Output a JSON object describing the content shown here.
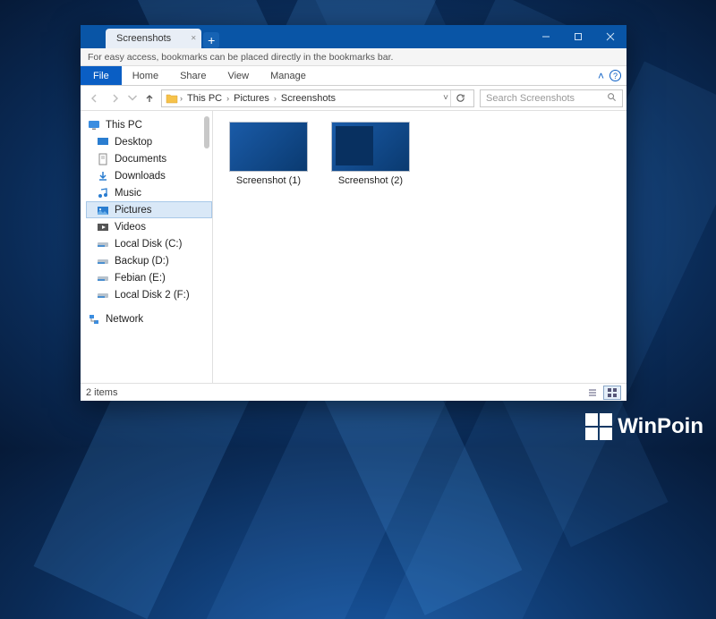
{
  "tab": {
    "title": "Screenshots",
    "close": "×",
    "new": "+"
  },
  "bookmarks_hint": "For easy access, bookmarks can be placed directly in the bookmarks bar.",
  "ribbon": {
    "file": "File",
    "tabs": [
      "Home",
      "Share",
      "View",
      "Manage"
    ]
  },
  "breadcrumb": [
    "This PC",
    "Pictures",
    "Screenshots"
  ],
  "search": {
    "placeholder": "Search Screenshots"
  },
  "sidebar": {
    "root_label": "This PC",
    "items": [
      {
        "label": "Desktop",
        "icon": "desktop"
      },
      {
        "label": "Documents",
        "icon": "doc"
      },
      {
        "label": "Downloads",
        "icon": "download"
      },
      {
        "label": "Music",
        "icon": "music"
      },
      {
        "label": "Pictures",
        "icon": "pictures",
        "selected": true
      },
      {
        "label": "Videos",
        "icon": "videos"
      },
      {
        "label": "Local Disk (C:)",
        "icon": "disk"
      },
      {
        "label": "Backup (D:)",
        "icon": "disk"
      },
      {
        "label": "Febian (E:)",
        "icon": "disk"
      },
      {
        "label": "Local Disk 2 (F:)",
        "icon": "disk"
      }
    ],
    "network_label": "Network"
  },
  "files": [
    {
      "label": "Screenshot (1)"
    },
    {
      "label": "Screenshot (2)"
    }
  ],
  "status": {
    "count_text": "2 items"
  },
  "watermark": "WinPoin"
}
